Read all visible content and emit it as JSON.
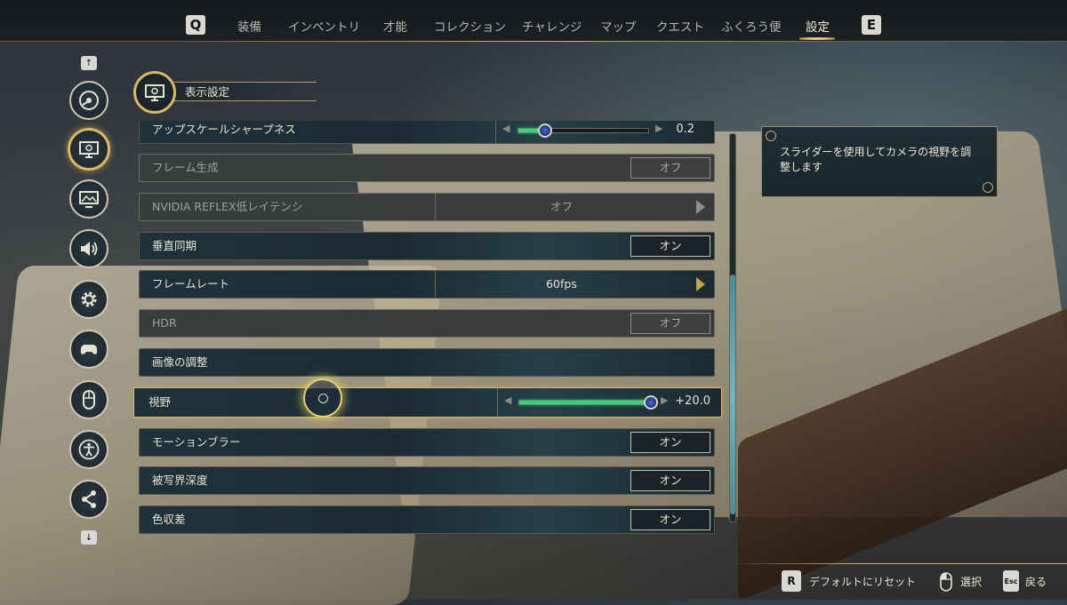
{
  "nav": {
    "left_key": "Q",
    "right_key": "E",
    "tabs": [
      {
        "label": "装備"
      },
      {
        "label": "インベントリ"
      },
      {
        "label": "才能"
      },
      {
        "label": "コレクション"
      },
      {
        "label": "チャレンジ"
      },
      {
        "label": "マップ"
      },
      {
        "label": "クエスト"
      },
      {
        "label": "ふくろう便"
      },
      {
        "label": "設定",
        "active": true
      }
    ]
  },
  "sidebar": {
    "up_key": "↑",
    "down_key": "↓",
    "items": [
      {
        "icon": "disc-icon"
      },
      {
        "icon": "display-icon",
        "active": true
      },
      {
        "icon": "graphics-icon"
      },
      {
        "icon": "speaker-icon"
      },
      {
        "icon": "gear-icon"
      },
      {
        "icon": "gamepad-icon"
      },
      {
        "icon": "mouse-icon"
      },
      {
        "icon": "accessibility-icon"
      },
      {
        "icon": "share-icon"
      }
    ]
  },
  "section": {
    "title": "表示設定"
  },
  "settings": [
    {
      "label": "アップスケールシャープネス",
      "type": "slider",
      "value": "0.2",
      "fraction": 0.2
    },
    {
      "label": "フレーム生成",
      "type": "toggle",
      "value": "オフ",
      "disabled": true
    },
    {
      "label": "NVIDIA REFLEX低レイテンシ",
      "type": "selector",
      "value": "オフ",
      "disabled": true
    },
    {
      "label": "垂直同期",
      "type": "toggle",
      "value": "オン"
    },
    {
      "label": "フレームレート",
      "type": "selector",
      "value": "60fps"
    },
    {
      "label": "HDR",
      "type": "toggle",
      "value": "オフ",
      "disabled": true
    },
    {
      "label": "画像の調整",
      "type": "button"
    },
    {
      "label": "視野",
      "type": "slider",
      "value": "+20.0",
      "fraction": 0.97,
      "selected": true
    },
    {
      "label": "モーションブラー",
      "type": "toggle",
      "value": "オン"
    },
    {
      "label": "被写界深度",
      "type": "toggle",
      "value": "オン"
    },
    {
      "label": "色収差",
      "type": "toggle",
      "value": "オン"
    }
  ],
  "tooltip": {
    "text": "スライダーを使用してカメラの視野を調整します"
  },
  "footer": {
    "reset_key": "R",
    "reset_label": "デフォルトにリセット",
    "select_label": "選択",
    "back_key": "Esc",
    "back_label": "戻る"
  },
  "colors": {
    "accent_gold": "#d8b866",
    "slider_green": "#39d27a"
  }
}
